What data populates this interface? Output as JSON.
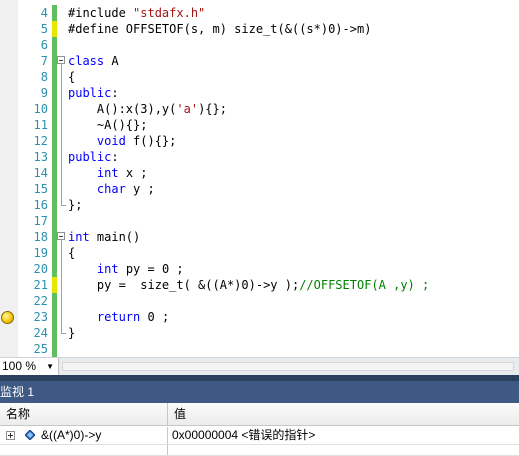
{
  "editor": {
    "lines": [
      {
        "num": "4",
        "segs": [
          {
            "t": "#include ",
            "c": ""
          },
          {
            "t": "\"stdafx.h\"",
            "c": "s"
          }
        ]
      },
      {
        "num": "5",
        "segs": [
          {
            "t": "#define OFFSETOF(s, m) size_t(&((s*)0)->m)",
            "c": ""
          }
        ]
      },
      {
        "num": "6",
        "segs": []
      },
      {
        "num": "7",
        "segs": [
          {
            "t": "class",
            "c": "k"
          },
          {
            "t": " A",
            "c": ""
          }
        ]
      },
      {
        "num": "8",
        "segs": [
          {
            "t": "{",
            "c": ""
          }
        ]
      },
      {
        "num": "9",
        "segs": [
          {
            "t": "public",
            "c": "k"
          },
          {
            "t": ":",
            "c": ""
          }
        ]
      },
      {
        "num": "10",
        "segs": [
          {
            "t": "    A():x(3),y(",
            "c": ""
          },
          {
            "t": "'a'",
            "c": "s"
          },
          {
            "t": "){};",
            "c": ""
          }
        ]
      },
      {
        "num": "11",
        "segs": [
          {
            "t": "    ~A(){};",
            "c": ""
          }
        ]
      },
      {
        "num": "12",
        "segs": [
          {
            "t": "    ",
            "c": ""
          },
          {
            "t": "void",
            "c": "k"
          },
          {
            "t": " f(){};",
            "c": ""
          }
        ]
      },
      {
        "num": "13",
        "segs": [
          {
            "t": "public",
            "c": "k"
          },
          {
            "t": ":",
            "c": ""
          }
        ]
      },
      {
        "num": "14",
        "segs": [
          {
            "t": "    ",
            "c": ""
          },
          {
            "t": "int",
            "c": "k"
          },
          {
            "t": " x ;",
            "c": ""
          }
        ]
      },
      {
        "num": "15",
        "segs": [
          {
            "t": "    ",
            "c": ""
          },
          {
            "t": "char",
            "c": "k"
          },
          {
            "t": " y ;",
            "c": ""
          }
        ]
      },
      {
        "num": "16",
        "segs": [
          {
            "t": "};",
            "c": ""
          }
        ]
      },
      {
        "num": "17",
        "segs": []
      },
      {
        "num": "18",
        "segs": [
          {
            "t": "int",
            "c": "k"
          },
          {
            "t": " main()",
            "c": ""
          }
        ]
      },
      {
        "num": "19",
        "segs": [
          {
            "t": "{",
            "c": ""
          }
        ]
      },
      {
        "num": "20",
        "segs": [
          {
            "t": "    ",
            "c": ""
          },
          {
            "t": "int",
            "c": "k"
          },
          {
            "t": " py = 0 ;",
            "c": ""
          }
        ]
      },
      {
        "num": "21",
        "segs": [
          {
            "t": "    py =  size_t( &((A*)0)->y );",
            "c": ""
          },
          {
            "t": "//OFFSETOF(A ,y) ;",
            "c": "c"
          }
        ]
      },
      {
        "num": "22",
        "segs": []
      },
      {
        "num": "23",
        "segs": [
          {
            "t": "    ",
            "c": ""
          },
          {
            "t": "return",
            "c": "k"
          },
          {
            "t": " 0 ;",
            "c": ""
          }
        ]
      },
      {
        "num": "24",
        "segs": [
          {
            "t": "}",
            "c": ""
          }
        ]
      },
      {
        "num": "25",
        "segs": []
      }
    ]
  },
  "statusbar": {
    "zoom": "100 %",
    "dropdown_icon": "chevron-down-icon"
  },
  "watch": {
    "title": "监视 1",
    "col_name": "名称",
    "col_value": "值",
    "rows": [
      {
        "name": "&((A*)0)->y",
        "value": "0x00000004 <错误的指针>"
      }
    ]
  },
  "colors": {
    "keyword": "#0000ff",
    "string": "#a31515",
    "comment": "#008000",
    "line_number": "#2b91af",
    "watch_title_bg": "#3e5a84"
  }
}
